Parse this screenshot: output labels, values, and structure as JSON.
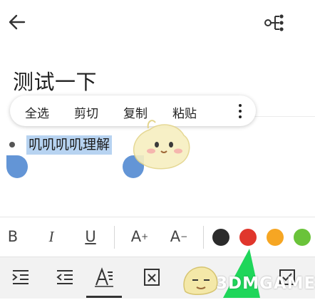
{
  "header": {
    "back_icon": "back-arrow-icon",
    "share_icon": "mind-map-share-icon"
  },
  "note": {
    "title": "测试一下",
    "bullet_text": "叽叽叽叽理解"
  },
  "context_menu": {
    "items": [
      "全选",
      "剪切",
      "复制",
      "粘贴"
    ],
    "more_icon": "more-vertical-icon"
  },
  "format_bar": {
    "bold": "B",
    "italic": "I",
    "underline": "U",
    "font_increase": "A",
    "font_decrease": "A",
    "colors": [
      "#2b2b2b",
      "#e0362c",
      "#f6a623",
      "#6ac33a"
    ]
  },
  "toolbar": {
    "items": [
      "indent-icon",
      "outdent-icon",
      "text-style-icon",
      "clear-format-icon",
      "checkbox-icon"
    ],
    "active_index": 2
  },
  "watermark": {
    "text": "3DMGAME"
  }
}
